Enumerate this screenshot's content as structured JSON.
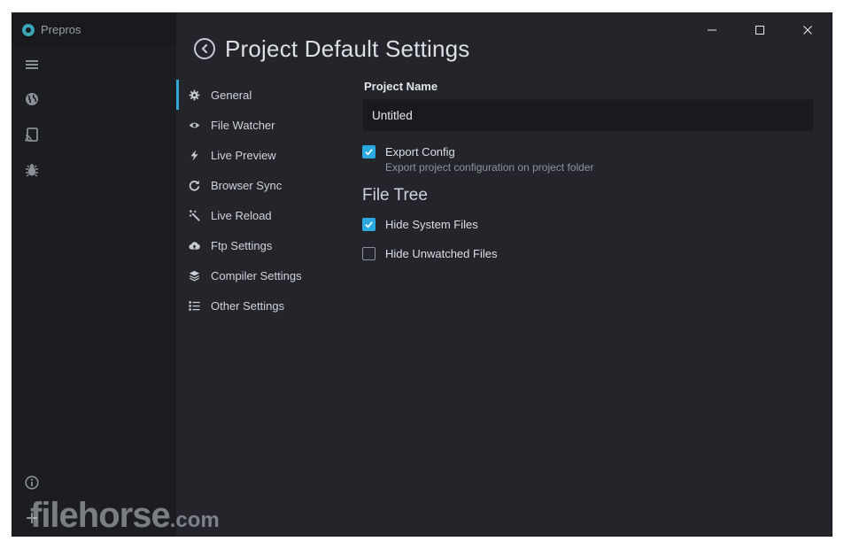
{
  "app": {
    "title": "Prepros"
  },
  "rail": {
    "icons": [
      "menu-icon",
      "globe-icon",
      "cast-icon",
      "bug-icon",
      "info-icon",
      "add-icon"
    ]
  },
  "window": {
    "controls": [
      "minimize",
      "maximize",
      "close"
    ]
  },
  "header": {
    "title": "Project Default Settings"
  },
  "nav": {
    "items": [
      {
        "label": "General",
        "icon": "gear-icon",
        "active": true
      },
      {
        "label": "File Watcher",
        "icon": "eye-icon"
      },
      {
        "label": "Live Preview",
        "icon": "bolt-icon"
      },
      {
        "label": "Browser Sync",
        "icon": "refresh-icon"
      },
      {
        "label": "Live Reload",
        "icon": "magic-wand-icon"
      },
      {
        "label": "Ftp Settings",
        "icon": "cloud-upload-icon"
      },
      {
        "label": "Compiler Settings",
        "icon": "layers-icon"
      },
      {
        "label": "Other Settings",
        "icon": "list-icon"
      }
    ]
  },
  "general": {
    "project_name_label": "Project Name",
    "project_name_value": "Untitled",
    "export_config": {
      "label": "Export Config",
      "description": "Export project configuration on project folder",
      "checked": true
    },
    "file_tree": {
      "heading": "File Tree",
      "hide_system_files": {
        "label": "Hide System Files",
        "checked": true
      },
      "hide_unwatched_files": {
        "label": "Hide Unwatched Files",
        "checked": false
      }
    }
  },
  "watermark": {
    "text": "filehorse",
    "suffix": ".com"
  },
  "colors": {
    "accent": "#29a9e0",
    "rail": "#1c1d21",
    "panel": "#23252b"
  }
}
